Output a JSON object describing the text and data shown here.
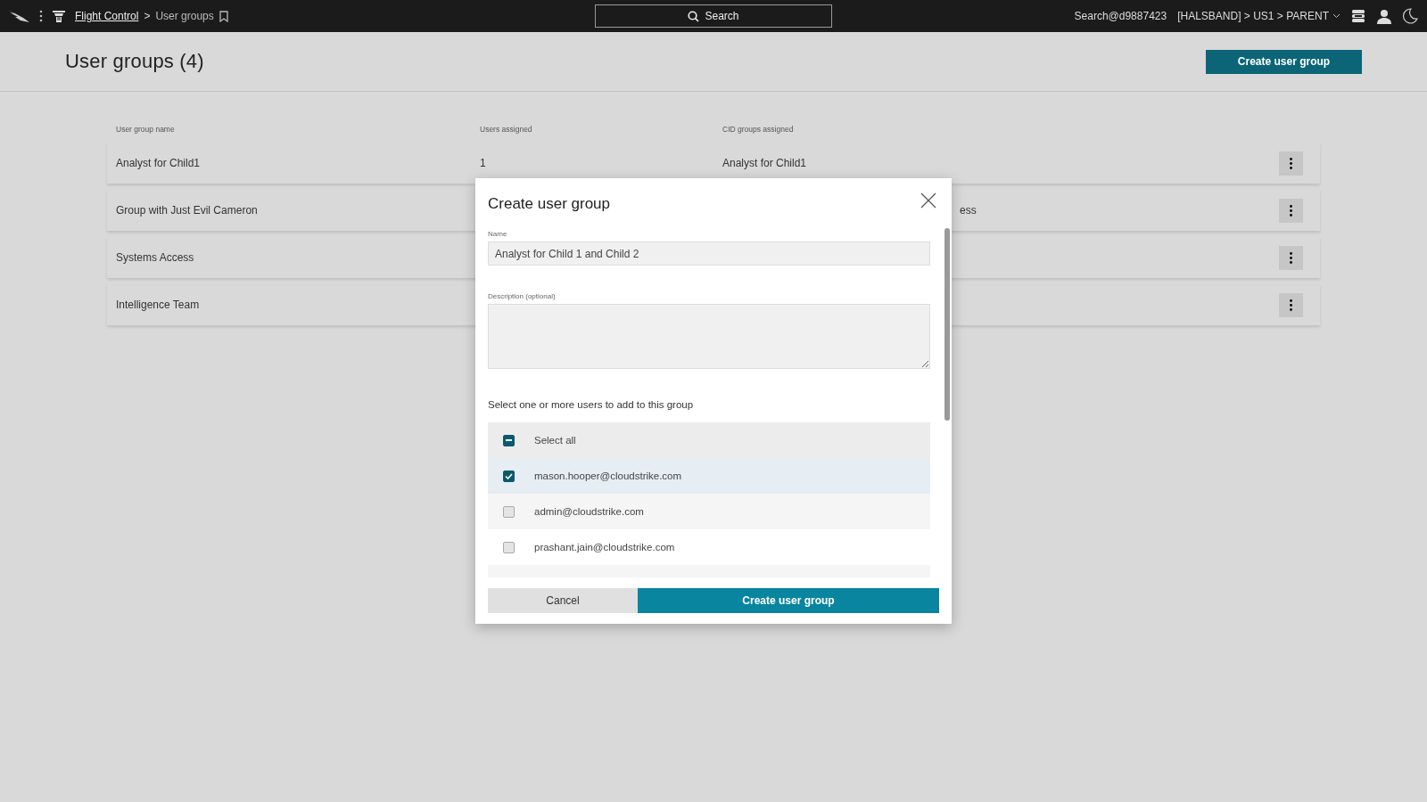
{
  "topbar": {
    "breadcrumb_link": "Flight Control",
    "breadcrumb_separator": ">",
    "breadcrumb_current": "User groups",
    "search_label": "Search",
    "account": "Search@d9887423",
    "tenant_path": "[HALSBAND] > US1 > PARENT"
  },
  "page": {
    "title": "User groups (4)",
    "create_button": "Create user group"
  },
  "table": {
    "columns": [
      "User group name",
      "Users assigned",
      "CID groups assigned"
    ],
    "rows": [
      {
        "name": "Analyst for Child1",
        "users": "1",
        "cid_groups": "Analyst for Child1"
      },
      {
        "name": "Group with Just Evil Cameron",
        "cid_groups": "ess"
      },
      {
        "name": "Systems Access"
      },
      {
        "name": "Intelligence Team"
      }
    ]
  },
  "dialog": {
    "title": "Create user group",
    "name_label": "Name",
    "name_value": "Analyst for Child 1 and Child 2",
    "description_label": "Description (optional)",
    "instruction": "Select one or more users to add to this group",
    "options": [
      {
        "kind": "select_all",
        "label": "Select all",
        "indeterminate": true
      },
      {
        "kind": "user",
        "label": "mason.hooper@cloudstrike.com",
        "checked": true
      },
      {
        "kind": "user",
        "label": "admin@cloudstrike.com",
        "checked": false
      },
      {
        "kind": "user",
        "label": "prashant.jain@cloudstrike.com",
        "checked": false
      }
    ],
    "cancel_button": "Cancel",
    "submit_button": "Create user group"
  }
}
